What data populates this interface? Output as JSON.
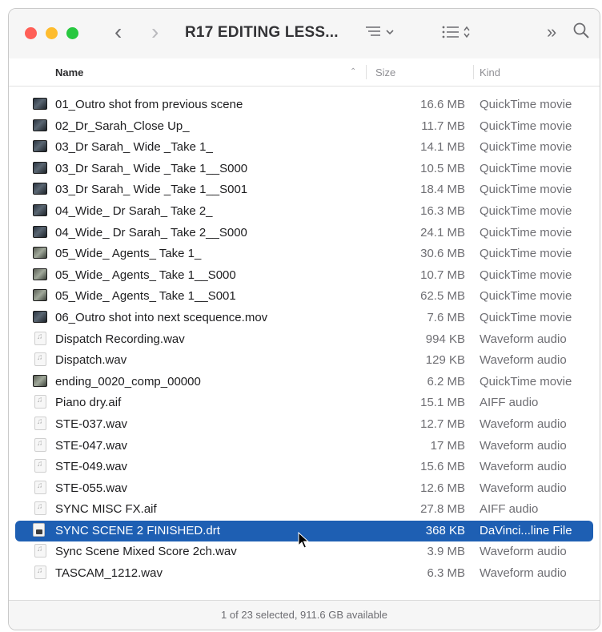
{
  "window": {
    "title": "R17 EDITING LESS...",
    "back_icon": "chevron-left-icon",
    "forward_icon": "chevron-right-icon",
    "list_view_icon": "list-view-icon",
    "group_icon": "group-icon",
    "more_icon": "more-icon",
    "search_icon": "search-icon"
  },
  "header": {
    "name": "Name",
    "size": "Size",
    "kind": "Kind",
    "sort_indicator": "^"
  },
  "files": [
    {
      "name": "01_Outro shot from previous scene",
      "size": "16.6 MB",
      "kind": "QuickTime movie",
      "icon": "video"
    },
    {
      "name": "02_Dr_Sarah_Close Up_",
      "size": "11.7 MB",
      "kind": "QuickTime movie",
      "icon": "video"
    },
    {
      "name": "03_Dr Sarah_ Wide _Take 1_",
      "size": "14.1 MB",
      "kind": "QuickTime movie",
      "icon": "video"
    },
    {
      "name": "03_Dr Sarah_ Wide _Take 1__S000",
      "size": "10.5 MB",
      "kind": "QuickTime movie",
      "icon": "video"
    },
    {
      "name": "03_Dr Sarah_ Wide _Take 1__S001",
      "size": "18.4 MB",
      "kind": "QuickTime movie",
      "icon": "video"
    },
    {
      "name": "04_Wide_ Dr Sarah_ Take 2_",
      "size": "16.3 MB",
      "kind": "QuickTime movie",
      "icon": "video"
    },
    {
      "name": "04_Wide_ Dr Sarah_ Take 2__S000",
      "size": "24.1 MB",
      "kind": "QuickTime movie",
      "icon": "video"
    },
    {
      "name": "05_Wide_ Agents_ Take 1_",
      "size": "30.6 MB",
      "kind": "QuickTime movie",
      "icon": "video-alt"
    },
    {
      "name": "05_Wide_ Agents_ Take 1__S000",
      "size": "10.7 MB",
      "kind": "QuickTime movie",
      "icon": "video-alt"
    },
    {
      "name": "05_Wide_ Agents_ Take 1__S001",
      "size": "62.5 MB",
      "kind": "QuickTime movie",
      "icon": "video-alt"
    },
    {
      "name": "06_Outro shot into next scequence.mov",
      "size": "7.6 MB",
      "kind": "QuickTime movie",
      "icon": "video"
    },
    {
      "name": "Dispatch Recording.wav",
      "size": "994 KB",
      "kind": "Waveform audio",
      "icon": "audio"
    },
    {
      "name": "Dispatch.wav",
      "size": "129 KB",
      "kind": "Waveform audio",
      "icon": "audio"
    },
    {
      "name": "ending_0020_comp_00000",
      "size": "6.2 MB",
      "kind": "QuickTime movie",
      "icon": "video-alt"
    },
    {
      "name": "Piano dry.aif",
      "size": "15.1 MB",
      "kind": "AIFF audio",
      "icon": "audio"
    },
    {
      "name": "STE-037.wav",
      "size": "12.7 MB",
      "kind": "Waveform audio",
      "icon": "audio"
    },
    {
      "name": "STE-047.wav",
      "size": "17 MB",
      "kind": "Waveform audio",
      "icon": "audio"
    },
    {
      "name": "STE-049.wav",
      "size": "15.6 MB",
      "kind": "Waveform audio",
      "icon": "audio"
    },
    {
      "name": "STE-055.wav",
      "size": "12.6 MB",
      "kind": "Waveform audio",
      "icon": "audio"
    },
    {
      "name": "SYNC MISC FX.aif",
      "size": "27.8 MB",
      "kind": "AIFF audio",
      "icon": "audio"
    },
    {
      "name": "SYNC SCENE 2 FINISHED.drt",
      "size": "368 KB",
      "kind": "DaVinci...line File",
      "icon": "doc",
      "selected": true
    },
    {
      "name": "Sync Scene Mixed Score 2ch.wav",
      "size": "3.9 MB",
      "kind": "Waveform audio",
      "icon": "audio"
    },
    {
      "name": "TASCAM_1212.wav",
      "size": "6.3 MB",
      "kind": "Waveform audio",
      "icon": "audio"
    }
  ],
  "status": "1 of 23 selected, 911.6 GB available",
  "colors": {
    "selection": "#1e5fb3",
    "close": "#ff5f57",
    "minimize": "#febc2e",
    "zoom": "#28c840"
  }
}
